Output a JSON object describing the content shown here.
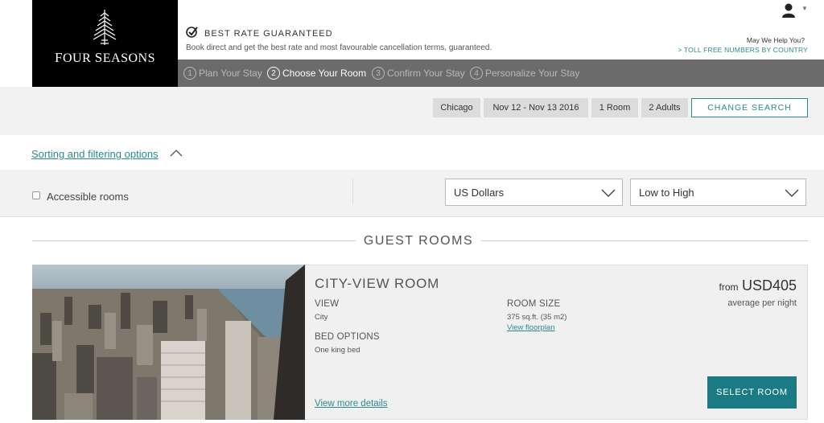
{
  "brand": {
    "logo_text_first": "F",
    "logo_text_rest1": "OUR ",
    "logo_text_second": "S",
    "logo_text_rest2": "EASONS"
  },
  "header": {
    "promo_title": "BEST RATE GUARANTEED",
    "promo_subtitle": "Book direct and get the best rate and most favourable cancellation terms, guaranteed.",
    "help_text": "May We Help You?",
    "toll_link": "> TOLL FREE NUMBERS BY COUNTRY"
  },
  "steps": [
    {
      "num": "1",
      "label": "Plan Your Stay",
      "active": false
    },
    {
      "num": "2",
      "label": "Choose Your Room",
      "active": true
    },
    {
      "num": "3",
      "label": "Confirm Your Stay",
      "active": false
    },
    {
      "num": "4",
      "label": "Personalize Your Stay",
      "active": false
    }
  ],
  "search": {
    "city": "Chicago",
    "dates": "Nov 12 - Nov 13 2016",
    "rooms": "1 Room",
    "guests": "2 Adults",
    "change_label": "CHANGE SEARCH"
  },
  "filters": {
    "sorting_link": "Sorting and filtering options",
    "accessible_label": "Accessible rooms",
    "accessible_checked": false,
    "currency": "US Dollars",
    "sort_order": "Low to High"
  },
  "section_title": "GUEST ROOMS",
  "room": {
    "name": "CITY-VIEW ROOM",
    "view_label": "VIEW",
    "view_value": "City",
    "bed_label": "BED OPTIONS",
    "bed_value": "One king bed",
    "size_label": "ROOM SIZE",
    "size_value": "375 sq.ft. (35 m2)",
    "floorplan_link": "View floorplan",
    "more_details": "View more details",
    "price_prefix": "from",
    "price": "USD405",
    "price_note": "average per night",
    "select_label": "SELECT ROOM"
  },
  "colors": {
    "accent": "#2c8a8f",
    "button": "#1a7b84",
    "steps_bar": "#6b6b6b"
  }
}
